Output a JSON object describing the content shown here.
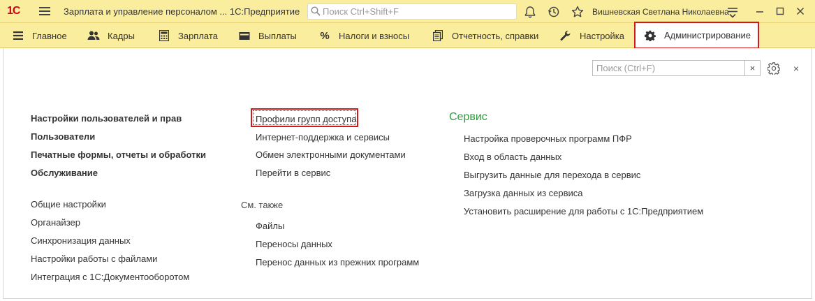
{
  "titlebar": {
    "logo": "1С",
    "app_title": "Зарплата и управление персоналом ...  1С:Предприятие",
    "search_placeholder": "Поиск Ctrl+Shift+F",
    "user_name": "Вишневская Светлана Николаевна",
    "icons": [
      "bell-icon",
      "history-icon",
      "star-icon",
      "settings-lines-icon",
      "minimize-icon",
      "maximize-icon",
      "close-icon"
    ]
  },
  "menu": {
    "items": [
      {
        "label": "Главное",
        "icon": "menu-lines-icon"
      },
      {
        "label": "Кадры",
        "icon": "people-icon"
      },
      {
        "label": "Зарплата",
        "icon": "calculator-icon"
      },
      {
        "label": "Выплаты",
        "icon": "wallet-icon"
      },
      {
        "label": "Налоги и взносы",
        "icon": "percent-icon"
      },
      {
        "label": "Отчетность, справки",
        "icon": "documents-icon"
      },
      {
        "label": "Настройка",
        "icon": "wrench-icon"
      },
      {
        "label": "Администрирование",
        "icon": "gear-icon",
        "active": true
      }
    ]
  },
  "panel": {
    "search_placeholder": "Поиск (Ctrl+F)",
    "clear_label": "×",
    "close_label": "×"
  },
  "col1": {
    "bold_links": [
      "Настройки пользователей и прав",
      "Пользователи",
      "Печатные формы, отчеты и обработки",
      "Обслуживание"
    ],
    "links": [
      "Общие настройки",
      "Органайзер",
      "Синхронизация данных",
      "Настройки работы с файлами",
      "Интеграция с 1С:Документооборотом"
    ]
  },
  "col2": {
    "links": [
      "Профили групп доступа",
      "Интернет-поддержка и сервисы",
      "Обмен электронными документами",
      "Перейти в сервис"
    ],
    "see_also_title": "См. также",
    "see_also_links": [
      "Файлы",
      "Переносы данных",
      "Перенос данных из прежних программ"
    ]
  },
  "col3": {
    "title": "Сервис",
    "title_color": "#2f9a3b",
    "links": [
      "Настройка проверочных программ ПФР",
      "Вход в область данных",
      "Выгрузить данные для перехода в сервис",
      "Загрузка данных из сервиса",
      "Установить расширение для работы с 1С:Предприятием"
    ]
  },
  "colors": {
    "toolbar_bg": "#fbed9e",
    "highlight": "#d11a1a",
    "section_green": "#2f9a3b"
  }
}
